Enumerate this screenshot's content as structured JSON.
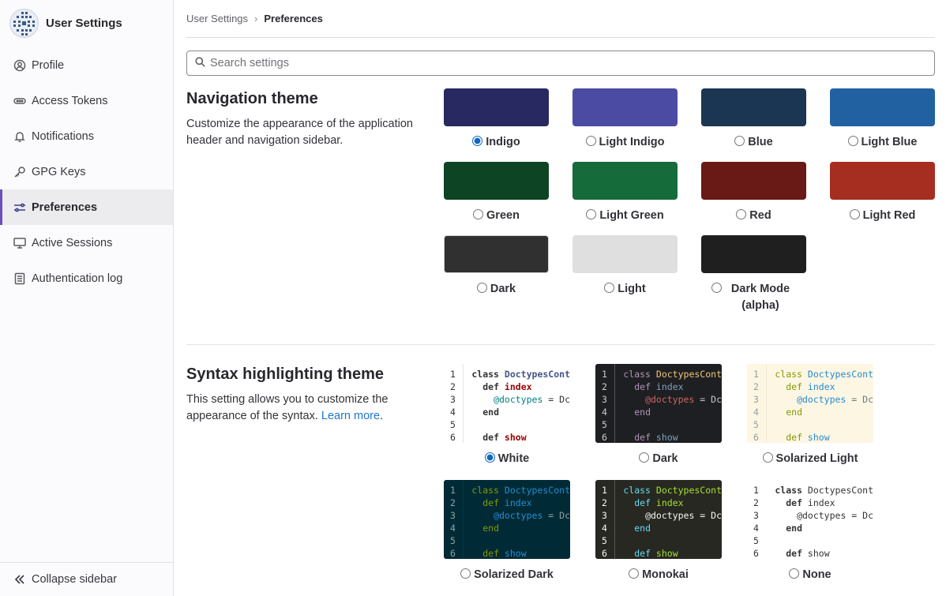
{
  "app": {
    "title": "User Settings"
  },
  "sidebar": {
    "items": [
      {
        "label": "Profile",
        "icon": "profile-icon"
      },
      {
        "label": "Access Tokens",
        "icon": "token-icon"
      },
      {
        "label": "Notifications",
        "icon": "bell-icon"
      },
      {
        "label": "GPG Keys",
        "icon": "key-icon"
      },
      {
        "label": "Preferences",
        "icon": "preferences-icon",
        "active": true
      },
      {
        "label": "Active Sessions",
        "icon": "monitor-icon"
      },
      {
        "label": "Authentication log",
        "icon": "log-icon"
      }
    ],
    "collapse_label": "Collapse sidebar"
  },
  "breadcrumb": {
    "parent": "User Settings",
    "current": "Preferences"
  },
  "search": {
    "placeholder": "Search settings"
  },
  "nav_theme": {
    "title": "Navigation theme",
    "description": "Customize the appearance of the application header and navigation sidebar.",
    "selected": "Indigo",
    "options": [
      {
        "label": "Indigo",
        "color": "#292961"
      },
      {
        "label": "Light Indigo",
        "color": "#4b4ba3"
      },
      {
        "label": "Blue",
        "color": "#1a3652"
      },
      {
        "label": "Light Blue",
        "color": "#2261a1"
      },
      {
        "label": "Green",
        "color": "#0d4524"
      },
      {
        "label": "Light Green",
        "color": "#156b39"
      },
      {
        "label": "Red",
        "color": "#691a16"
      },
      {
        "label": "Light Red",
        "color": "#a62e21"
      },
      {
        "label": "Dark",
        "color": "#303030"
      },
      {
        "label": "Light",
        "color": "#dfdfdf"
      },
      {
        "label": "Dark Mode (alpha)",
        "color": "#1f1f1f"
      }
    ]
  },
  "syntax_theme": {
    "title": "Syntax highlighting theme",
    "description": "This setting allows you to customize the appearance of the syntax.",
    "learn_more": "Learn more",
    "description_end": ".",
    "selected": "White",
    "code_sample": {
      "line_numbers": [
        "1",
        "2",
        "3",
        "4",
        "5",
        "6"
      ],
      "line1_kw": "class ",
      "line1_cls": "DoctypesCont",
      "line2_kw": "def ",
      "line2_fn": "index",
      "line3_iv": "@doctypes",
      "line3_tx": " = Dc",
      "line4_kw": "end",
      "line6_kw": "def ",
      "line6_fn": "show"
    },
    "options": [
      {
        "label": "White",
        "style": "white"
      },
      {
        "label": "Dark",
        "style": "dark"
      },
      {
        "label": "Solarized Light",
        "style": "sol-light"
      },
      {
        "label": "Solarized Dark",
        "style": "sol-dark"
      },
      {
        "label": "Monokai",
        "style": "monokai"
      },
      {
        "label": "None",
        "style": "none"
      }
    ]
  }
}
